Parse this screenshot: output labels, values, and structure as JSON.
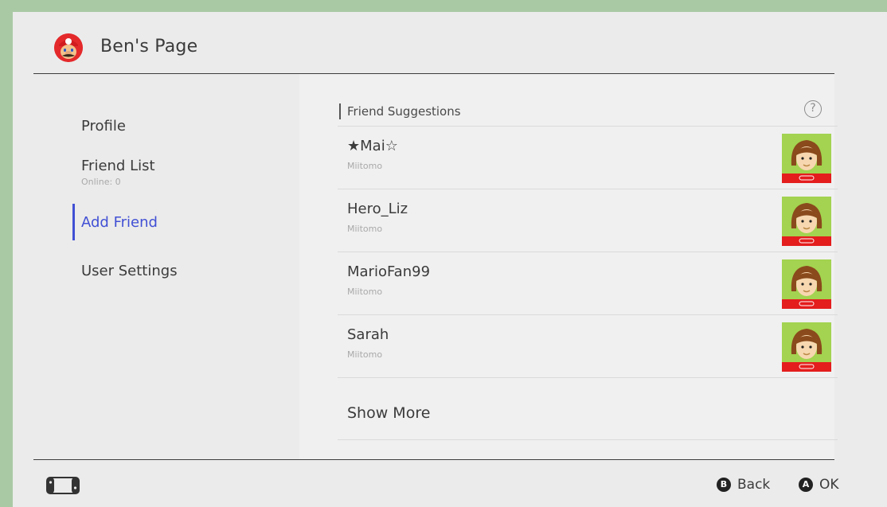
{
  "header": {
    "title": "Ben's Page",
    "avatar_icon": "mario-avatar-icon"
  },
  "sidebar": {
    "items": [
      {
        "label": "Profile",
        "sub": ""
      },
      {
        "label": "Friend List",
        "sub": "Online: 0"
      },
      {
        "label": "Add Friend",
        "sub": "",
        "active": true
      },
      {
        "label": "User Settings",
        "sub": ""
      }
    ],
    "accent_color": "#4150d4"
  },
  "main": {
    "section_title": "Friend Suggestions",
    "help_icon": "?",
    "suggestions": [
      {
        "name": "★Mai☆",
        "source": "Miitomo"
      },
      {
        "name": "Hero_Liz",
        "source": "Miitomo"
      },
      {
        "name": "MarioFan99",
        "source": "Miitomo"
      },
      {
        "name": "Sarah",
        "source": "Miitomo"
      }
    ],
    "show_more_label": "Show More"
  },
  "footer": {
    "back": {
      "button": "B",
      "label": "Back"
    },
    "ok": {
      "button": "A",
      "label": "OK"
    }
  }
}
